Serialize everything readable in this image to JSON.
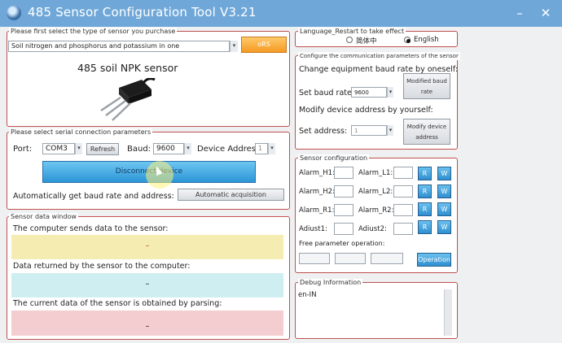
{
  "window": {
    "title": "485 Sensor Configuration Tool V3.21",
    "minimize": "–",
    "close": "✕"
  },
  "sensor_type": {
    "group_label": "Please first select the type of sensor you purchase",
    "selected": "Soil nitrogen and phosphorus and potassium in one",
    "button_label": "oRS",
    "sensor_name": "485 soil NPK sensor",
    "image_icon": "npk-probe-icon"
  },
  "language": {
    "group_label": "Language_Restart to take effect",
    "options": [
      "简体中",
      "English"
    ],
    "selected": "English"
  },
  "comm_params": {
    "group_label": "Configure the communication parameters of the sensor",
    "baud_heading": "Change equipment baud rate by oneself:",
    "baud_label": "Set baud rate:",
    "baud_value": "9600",
    "baud_button": "Modified baud rate",
    "address_heading": "Modify device address by yourself:",
    "address_label": "Set address:",
    "address_value": "1",
    "address_button": "Modify device address"
  },
  "serial": {
    "group_label": "Please select serial connection parameters",
    "port_label": "Port:",
    "port_value": "COM3",
    "refresh_button": "Refresh",
    "baud_label": "Baud:",
    "baud_value": "9600",
    "address_label": "Device Address:",
    "address_value": "1",
    "connect_button": "Disconnect device",
    "auto_label": "Automatically get baud rate and address:",
    "auto_button": "Automatic acquisition"
  },
  "sensor_config": {
    "group_label": "Sensor configuration",
    "rows": [
      {
        "left": "Alarm_H1:",
        "right": "Alarm_L1:"
      },
      {
        "left": "Alarm_H2:",
        "right": "Alarm_L2:"
      },
      {
        "left": "Alarm_R1:",
        "right": "Alarm_R2:"
      },
      {
        "left": "Adiust1:",
        "right": "Adiust2:"
      }
    ],
    "read_label": "R",
    "write_label": "W",
    "free_label": "Free parameter operation:",
    "operation_button": "Operation"
  },
  "data_window": {
    "group_label": "Sensor data window",
    "send_label": "The computer sends data to the sensor:",
    "send_value": "–",
    "return_label": "Data returned by the sensor to the computer:",
    "return_value": "–",
    "parsed_label": "The current data of the sensor is obtained by parsing:",
    "parsed_value": "–"
  },
  "debug": {
    "group_label": "Debug Information",
    "content": "en-IN"
  },
  "colors": {
    "titlebar": "#6fa8d8",
    "group_border": "#c0504d",
    "send_band": "#f4ecb0",
    "return_band": "#cfeef2",
    "parsed_band": "#f4cdd0",
    "accent_button": "#2b95d6"
  }
}
